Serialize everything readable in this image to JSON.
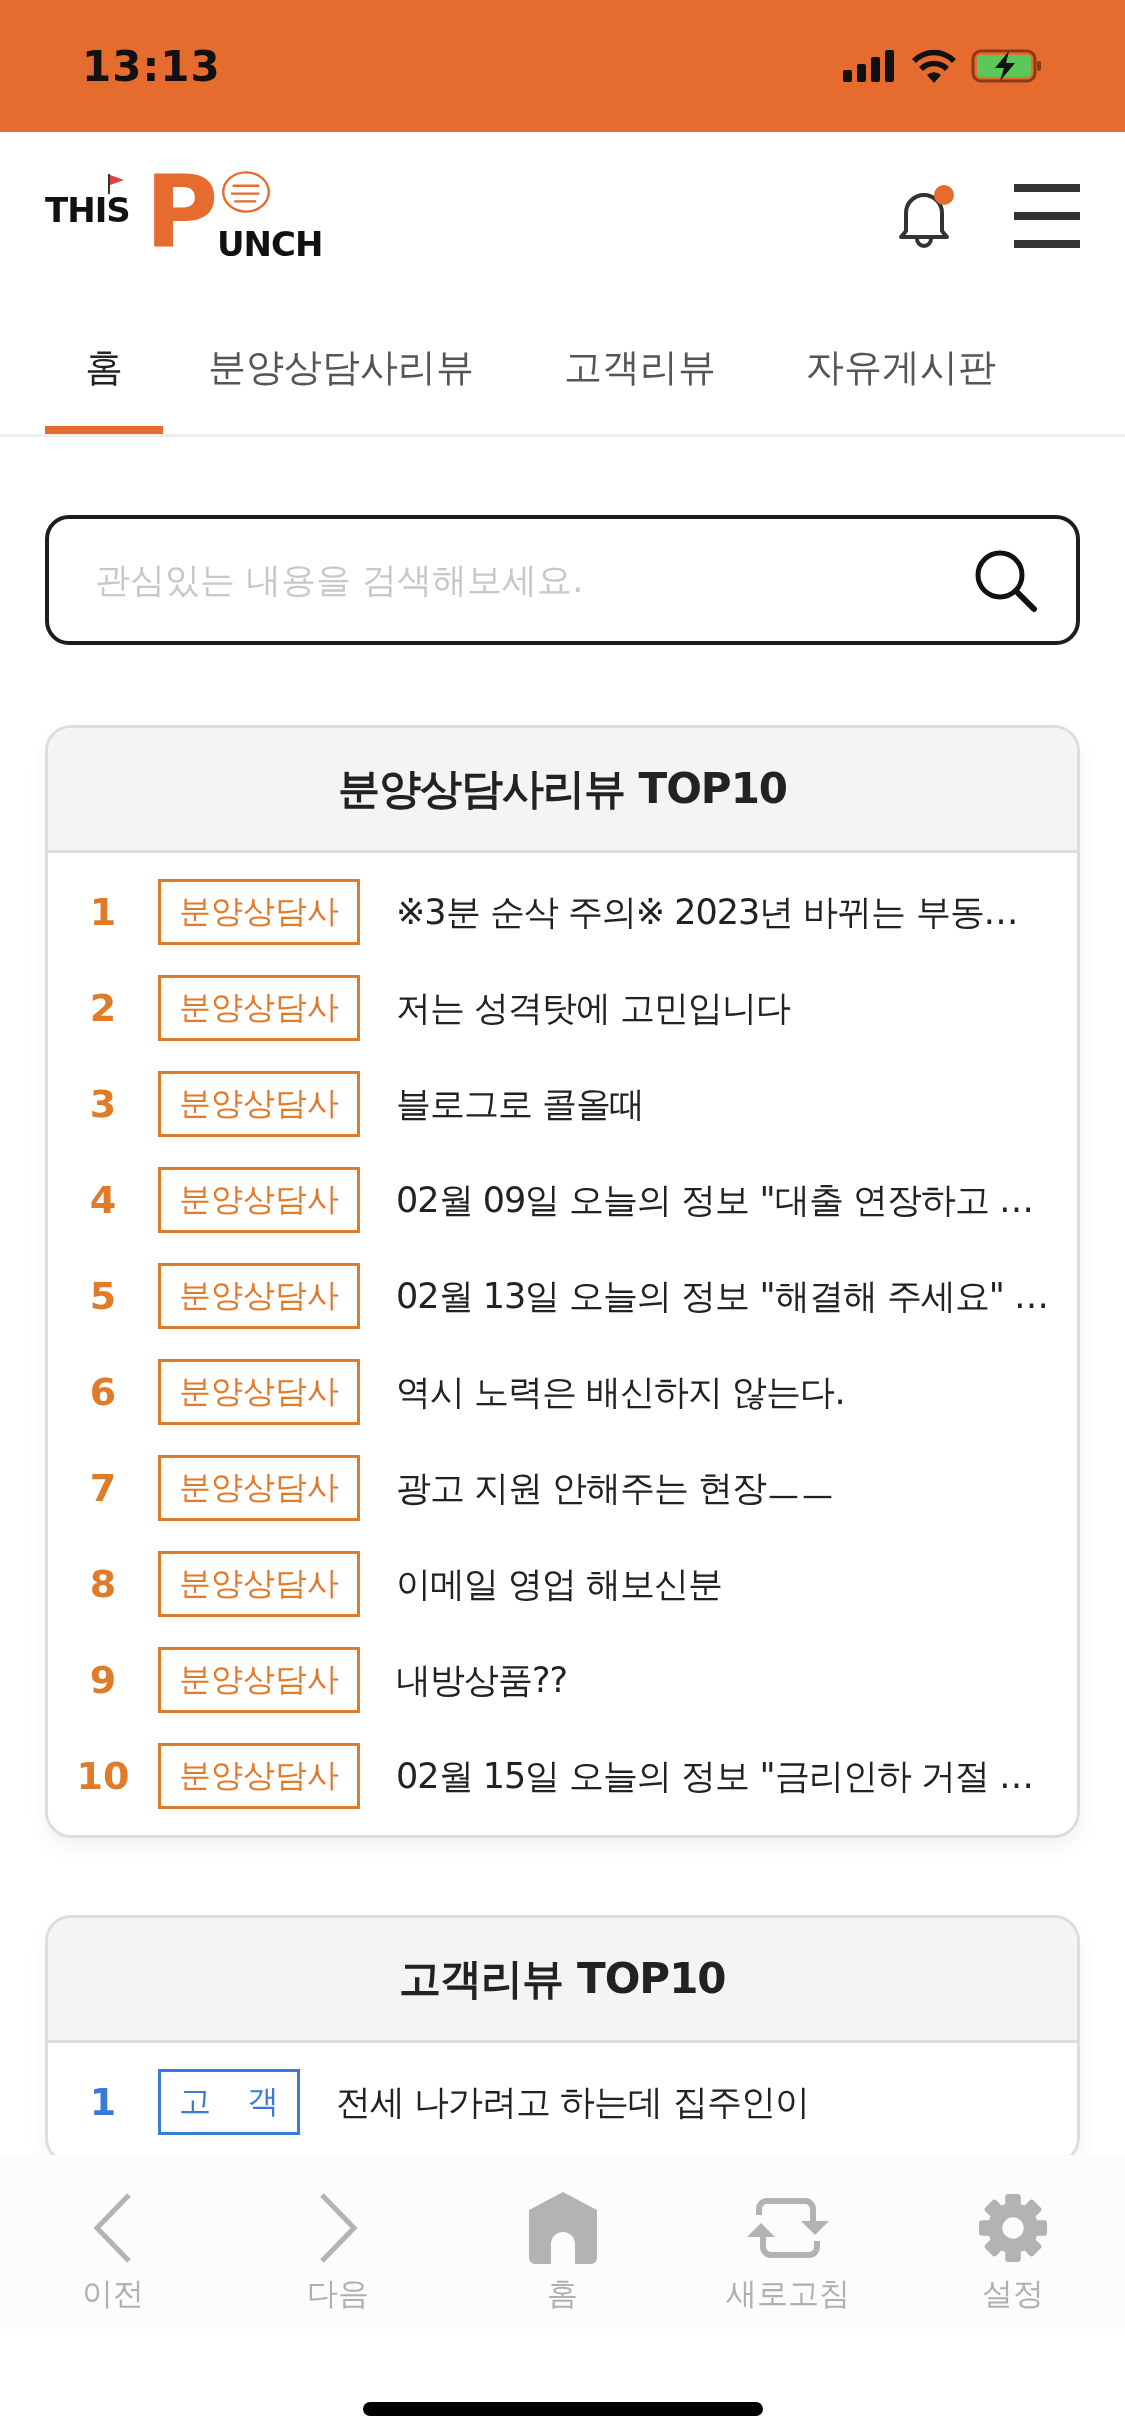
{
  "status_bar": {
    "time": "13:13"
  },
  "header": {
    "logo": {
      "top": "THIS",
      "letter": "P",
      "rest": "UNCH"
    },
    "notification_badge": true
  },
  "tabs": [
    {
      "label": "홈",
      "selected": true
    },
    {
      "label": "분양상담사리뷰",
      "selected": false
    },
    {
      "label": "고객리뷰",
      "selected": false
    },
    {
      "label": "자유게시판",
      "selected": false
    }
  ],
  "search": {
    "placeholder": "관심있는 내용을 검색해보세요."
  },
  "sections": [
    {
      "title": "분양상담사리뷰 TOP10",
      "color": "#e07b2a",
      "rows": [
        {
          "rank": "1",
          "tag": "분양상담사",
          "title": "※3분 순삭 주의※ 2023년 바뀌는 부동…"
        },
        {
          "rank": "2",
          "tag": "분양상담사",
          "title": "저는 성격탓에 고민입니다"
        },
        {
          "rank": "3",
          "tag": "분양상담사",
          "title": "블로그로 콜올때"
        },
        {
          "rank": "4",
          "tag": "분양상담사",
          "title": "02월 09일 오늘의 정보 \"대출 연장하고 …"
        },
        {
          "rank": "5",
          "tag": "분양상담사",
          "title": "02월 13일 오늘의 정보 \"해결해 주세요\" …"
        },
        {
          "rank": "6",
          "tag": "분양상담사",
          "title": "역시 노력은 배신하지 않는다."
        },
        {
          "rank": "7",
          "tag": "분양상담사",
          "title": "광고 지원 안해주는 현장ㅡㅡ"
        },
        {
          "rank": "8",
          "tag": "분양상담사",
          "title": "이메일 영업 해보신분"
        },
        {
          "rank": "9",
          "tag": "분양상담사",
          "title": "내방상품??"
        },
        {
          "rank": "10",
          "tag": "분양상담사",
          "title": "02월 15일 오늘의 정보 \"금리인하 거절 …"
        }
      ]
    },
    {
      "title": "고객리뷰 TOP10",
      "color": "#3a7bd5",
      "rows": [
        {
          "rank": "1",
          "tag": "고 객",
          "title": "전세 나가려고 하는데 집주인이"
        }
      ]
    }
  ],
  "bottom_nav": [
    {
      "label": "이전"
    },
    {
      "label": "다음"
    },
    {
      "label": "홈"
    },
    {
      "label": "새로고침"
    },
    {
      "label": "설정"
    }
  ]
}
